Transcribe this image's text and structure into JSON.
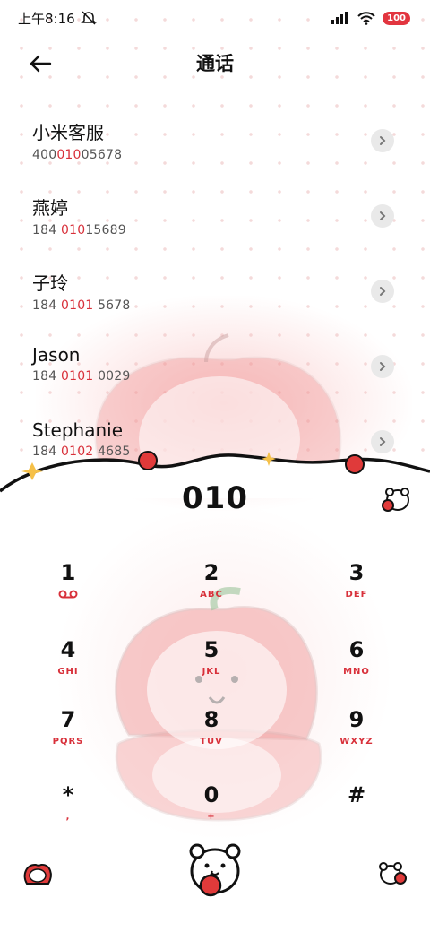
{
  "status_bar": {
    "time": "上午8:16",
    "battery": "100"
  },
  "header": {
    "title": "通话"
  },
  "contacts": [
    {
      "name": "小米客服",
      "num_pre": "400",
      "num_hl": "010",
      "num_post": "05678"
    },
    {
      "name": "燕婷",
      "num_pre": "184 ",
      "num_hl": "010",
      "num_post": "15689"
    },
    {
      "name": "子玲",
      "num_pre": "184 ",
      "num_hl": "0101",
      "num_post": " 5678"
    },
    {
      "name": "Jason",
      "num_pre": "184 ",
      "num_hl": "0101",
      "num_post": " 0029"
    },
    {
      "name": "Stephanie",
      "num_pre": "184 ",
      "num_hl": "0102",
      "num_post": " 4685"
    }
  ],
  "dialer": {
    "number": "010",
    "keys": [
      {
        "digit": "1",
        "letters": ""
      },
      {
        "digit": "2",
        "letters": "ABC"
      },
      {
        "digit": "3",
        "letters": "DEF"
      },
      {
        "digit": "4",
        "letters": "GHI"
      },
      {
        "digit": "5",
        "letters": "JKL"
      },
      {
        "digit": "6",
        "letters": "MNO"
      },
      {
        "digit": "7",
        "letters": "PQRS"
      },
      {
        "digit": "8",
        "letters": "TUV"
      },
      {
        "digit": "9",
        "letters": "WXYZ"
      },
      {
        "digit": "*",
        "letters": ","
      },
      {
        "digit": "0",
        "letters": "+"
      },
      {
        "digit": "#",
        "letters": ""
      }
    ]
  },
  "colors": {
    "accent": "#d8303a",
    "background": "#ffffff"
  },
  "icons": [
    "back-arrow-icon",
    "voicemail-icon",
    "chevron-right-icon",
    "wifi-icon",
    "signal-icon",
    "mute-icon"
  ]
}
